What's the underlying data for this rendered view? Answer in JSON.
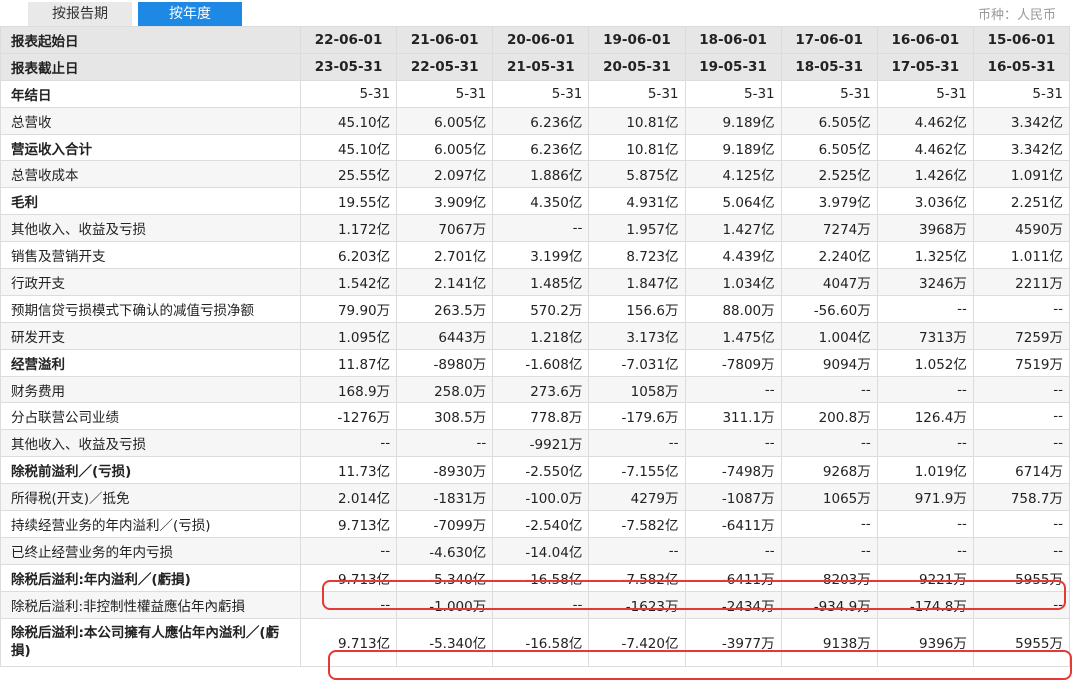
{
  "tabs": {
    "by_period": "按报告期",
    "by_year": "按年度"
  },
  "currency_label": "币种：人民币",
  "columns": [
    "22-06-01",
    "21-06-01",
    "20-06-01",
    "19-06-01",
    "18-06-01",
    "17-06-01",
    "16-06-01",
    "15-06-01"
  ],
  "header_rows": [
    {
      "label": "报表起始日",
      "values": [
        "22-06-01",
        "21-06-01",
        "20-06-01",
        "19-06-01",
        "18-06-01",
        "17-06-01",
        "16-06-01",
        "15-06-01"
      ]
    },
    {
      "label": "报表截止日",
      "values": [
        "23-05-31",
        "22-05-31",
        "21-05-31",
        "20-05-31",
        "19-05-31",
        "18-05-31",
        "17-05-31",
        "16-05-31"
      ]
    }
  ],
  "rows": [
    {
      "label": "年结日",
      "bold": true,
      "values": [
        "5-31",
        "5-31",
        "5-31",
        "5-31",
        "5-31",
        "5-31",
        "5-31",
        "5-31"
      ]
    },
    {
      "label": "总营收",
      "bold": false,
      "values": [
        "45.10亿",
        "6.005亿",
        "6.236亿",
        "10.81亿",
        "9.189亿",
        "6.505亿",
        "4.462亿",
        "3.342亿"
      ]
    },
    {
      "label": "营运收入合计",
      "bold": true,
      "values": [
        "45.10亿",
        "6.005亿",
        "6.236亿",
        "10.81亿",
        "9.189亿",
        "6.505亿",
        "4.462亿",
        "3.342亿"
      ]
    },
    {
      "label": "总营收成本",
      "bold": false,
      "values": [
        "25.55亿",
        "2.097亿",
        "1.886亿",
        "5.875亿",
        "4.125亿",
        "2.525亿",
        "1.426亿",
        "1.091亿"
      ]
    },
    {
      "label": "毛利",
      "bold": true,
      "values": [
        "19.55亿",
        "3.909亿",
        "4.350亿",
        "4.931亿",
        "5.064亿",
        "3.979亿",
        "3.036亿",
        "2.251亿"
      ]
    },
    {
      "label": "其他收入、收益及亏损",
      "bold": false,
      "values": [
        "1.172亿",
        "7067万",
        "--",
        "1.957亿",
        "1.427亿",
        "7274万",
        "3968万",
        "4590万"
      ]
    },
    {
      "label": "销售及营销开支",
      "bold": false,
      "values": [
        "6.203亿",
        "2.701亿",
        "3.199亿",
        "8.723亿",
        "4.439亿",
        "2.240亿",
        "1.325亿",
        "1.011亿"
      ]
    },
    {
      "label": "行政开支",
      "bold": false,
      "values": [
        "1.542亿",
        "2.141亿",
        "1.485亿",
        "1.847亿",
        "1.034亿",
        "4047万",
        "3246万",
        "2211万"
      ]
    },
    {
      "label": "预期信贷亏损模式下确认的减值亏损净额",
      "bold": false,
      "values": [
        "79.90万",
        "263.5万",
        "570.2万",
        "156.6万",
        "88.00万",
        "-56.60万",
        "--",
        "--"
      ]
    },
    {
      "label": "研发开支",
      "bold": false,
      "values": [
        "1.095亿",
        "6443万",
        "1.218亿",
        "3.173亿",
        "1.475亿",
        "1.004亿",
        "7313万",
        "7259万"
      ]
    },
    {
      "label": "经营溢利",
      "bold": true,
      "values": [
        "11.87亿",
        "-8980万",
        "-1.608亿",
        "-7.031亿",
        "-7809万",
        "9094万",
        "1.052亿",
        "7519万"
      ]
    },
    {
      "label": "财务费用",
      "bold": false,
      "values": [
        "168.9万",
        "258.0万",
        "273.6万",
        "1058万",
        "--",
        "--",
        "--",
        "--"
      ]
    },
    {
      "label": "分占联营公司业绩",
      "bold": false,
      "values": [
        "-1276万",
        "308.5万",
        "778.8万",
        "-179.6万",
        "311.1万",
        "200.8万",
        "126.4万",
        "--"
      ]
    },
    {
      "label": "其他收入、收益及亏损",
      "bold": false,
      "values": [
        "--",
        "--",
        "-9921万",
        "--",
        "--",
        "--",
        "--",
        "--"
      ]
    },
    {
      "label": "除税前溢利／(亏损)",
      "bold": true,
      "values": [
        "11.73亿",
        "-8930万",
        "-2.550亿",
        "-7.155亿",
        "-7498万",
        "9268万",
        "1.019亿",
        "6714万"
      ]
    },
    {
      "label": "所得税(开支)／抵免",
      "bold": false,
      "values": [
        "2.014亿",
        "-1831万",
        "-100.0万",
        "4279万",
        "-1087万",
        "1065万",
        "971.9万",
        "758.7万"
      ]
    },
    {
      "label": "持续经营业务的年内溢利／(亏损)",
      "bold": false,
      "values": [
        "9.713亿",
        "-7099万",
        "-2.540亿",
        "-7.582亿",
        "-6411万",
        "--",
        "--",
        "--"
      ]
    },
    {
      "label": "已终止经营业务的年内亏损",
      "bold": false,
      "values": [
        "--",
        "-4.630亿",
        "-14.04亿",
        "--",
        "--",
        "--",
        "--",
        "--"
      ]
    },
    {
      "label": "除税后溢利:年内溢利／(虧損)",
      "bold": true,
      "values": [
        "9.713亿",
        "-5.340亿",
        "-16.58亿",
        "-7.582亿",
        "-6411万",
        "8203万",
        "9221万",
        "5955万"
      ]
    },
    {
      "label": "除税后溢利:非控制性權益應佔年內虧損",
      "bold": false,
      "values": [
        "--",
        "-1.000万",
        "--",
        "-1623万",
        "-2434万",
        "-934.9万",
        "-174.8万",
        "--"
      ]
    },
    {
      "label": "除税后溢利:本公司擁有人應佔年內溢利／(虧損)",
      "bold": true,
      "tall": true,
      "values": [
        "9.713亿",
        "-5.340亿",
        "-16.58亿",
        "-7.420亿",
        "-3977万",
        "9138万",
        "9396万",
        "5955万"
      ]
    }
  ]
}
